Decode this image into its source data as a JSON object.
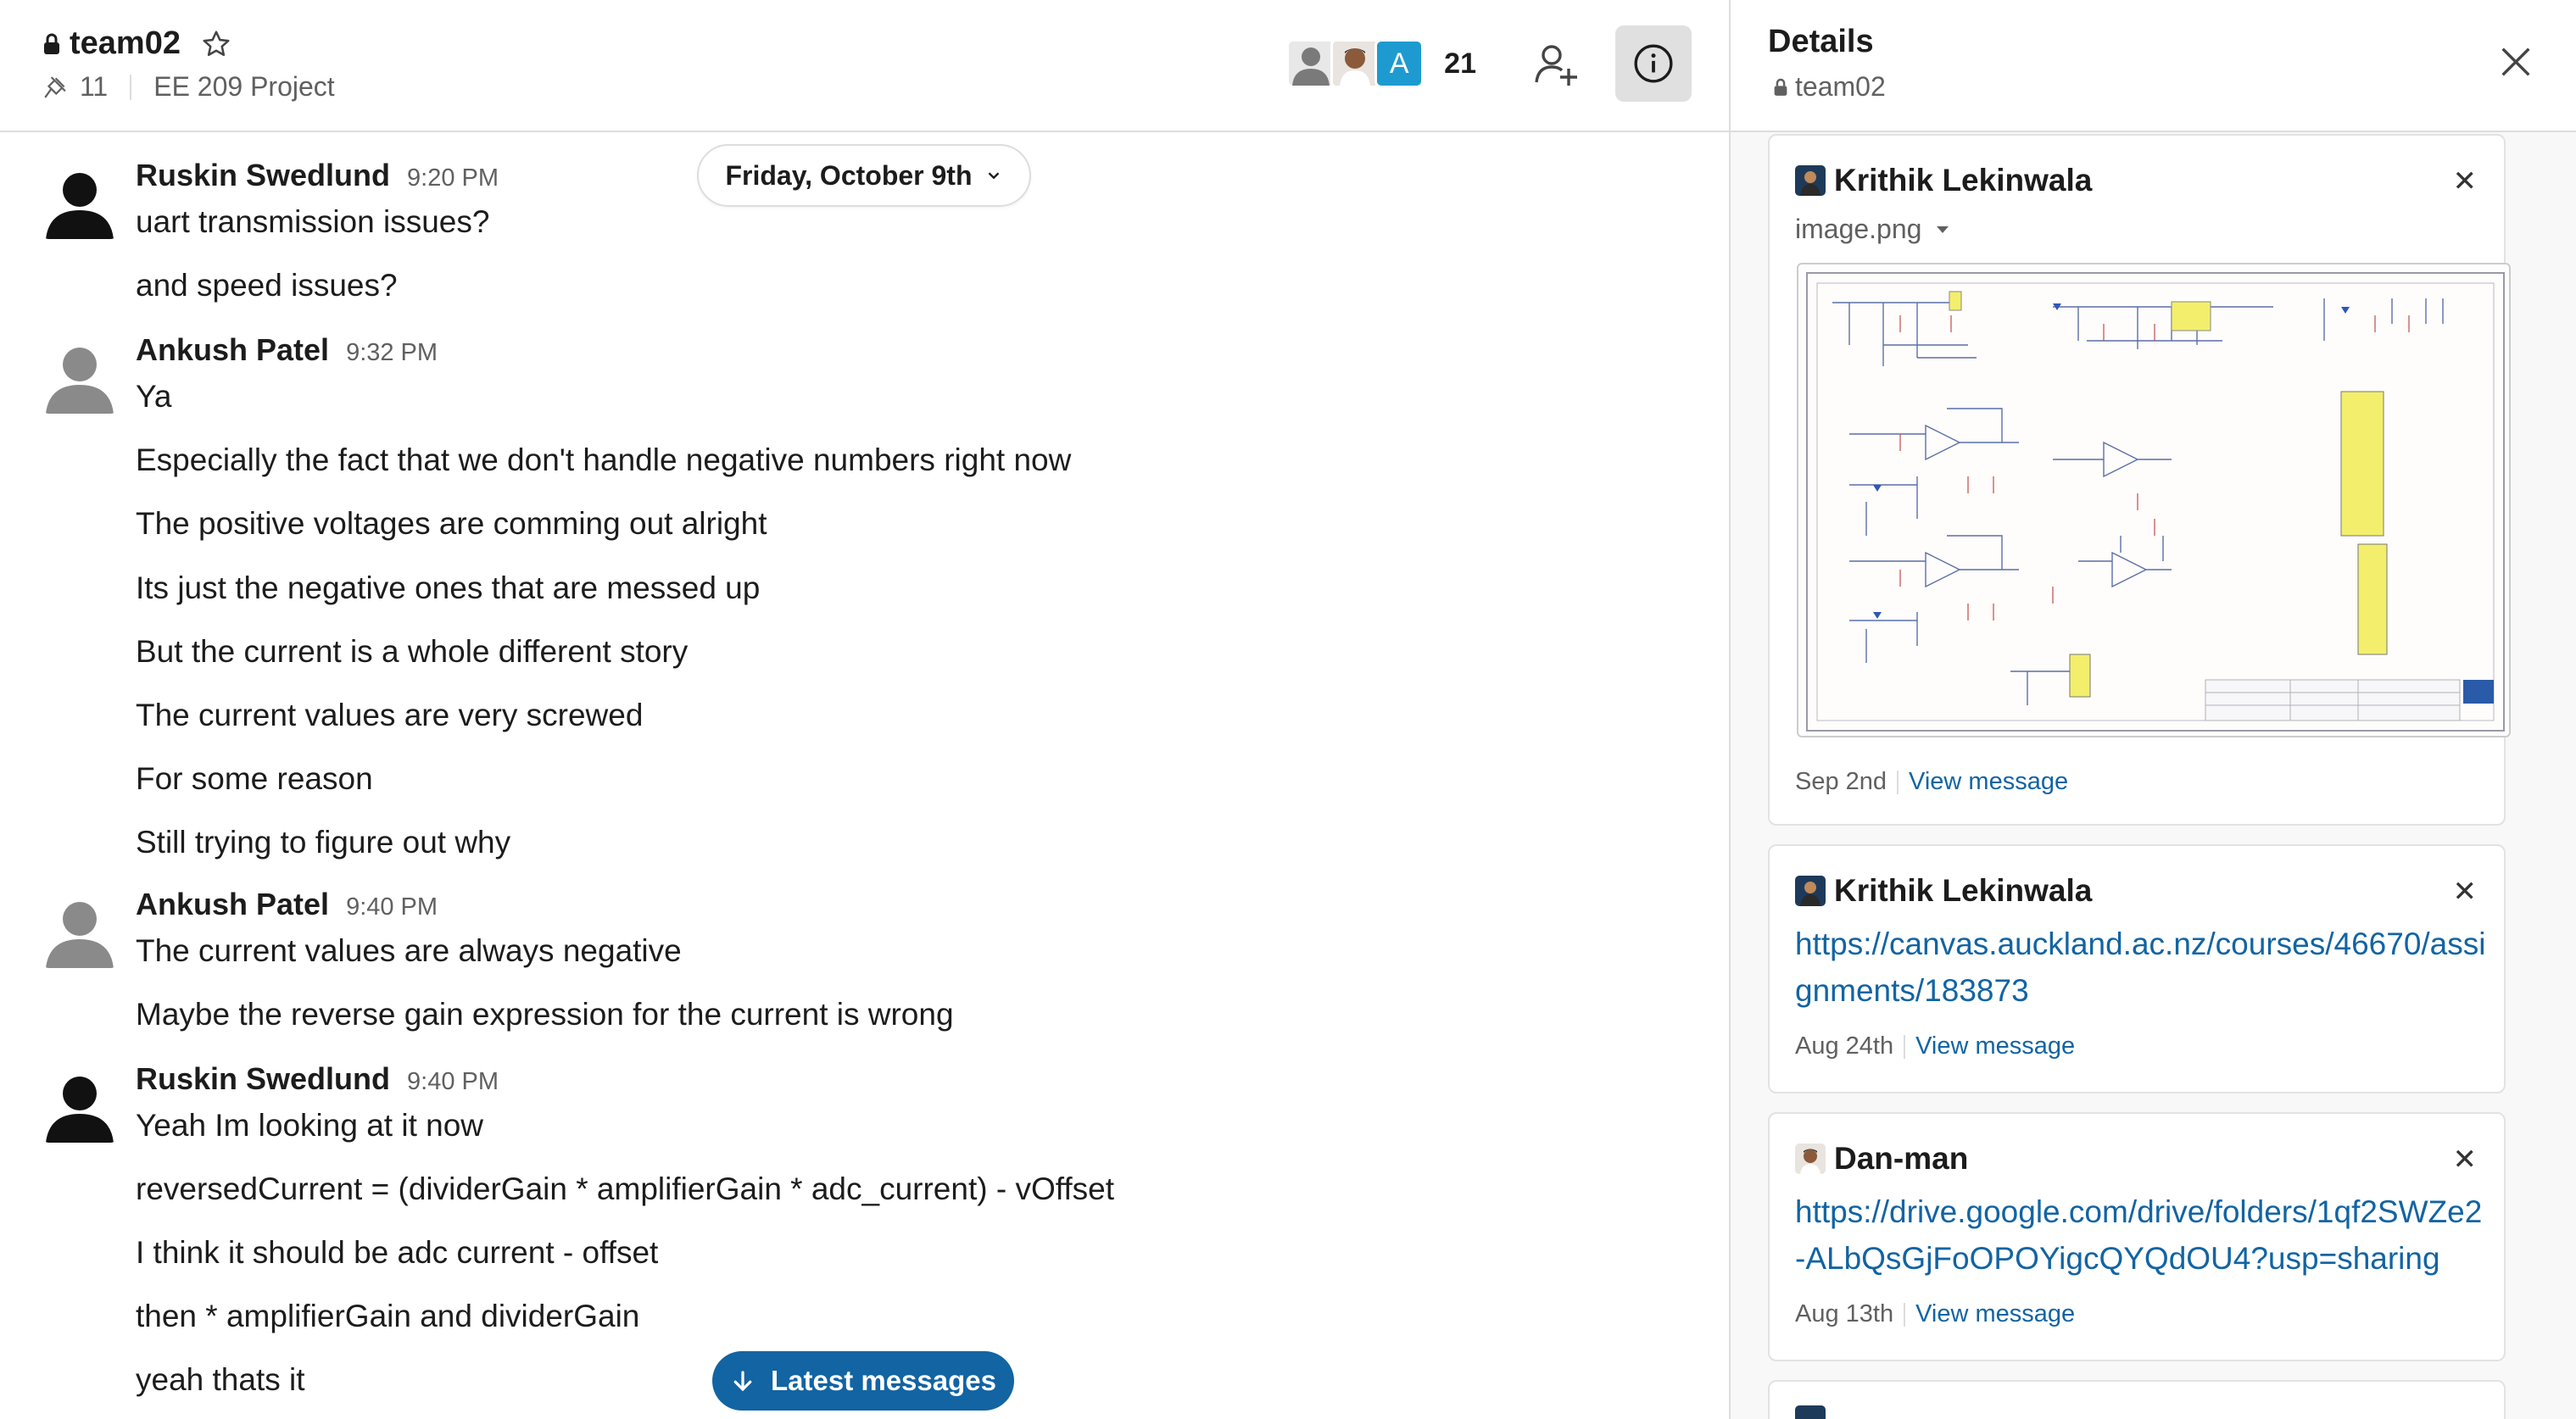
{
  "header": {
    "channel_name": "team02",
    "pinned_count": "11",
    "topic": "EE 209 Project",
    "avatar_letter": "A",
    "member_count": "21"
  },
  "date_divider": "Friday, October 9th",
  "messages": [
    {
      "author": "Ruskin Swedlund",
      "time": "9:20 PM",
      "lines": [
        "uart transmission issues?",
        "and speed issues?"
      ]
    },
    {
      "author": "Ankush Patel",
      "time": "9:32 PM",
      "lines": [
        "Ya",
        "Especially the fact that we don't handle negative numbers right now",
        "The positive voltages are comming out alright",
        "Its just the negative ones that are messed up",
        "But the current is a whole different story",
        "The current values are very screwed",
        "For some reason",
        "Still trying to figure out why"
      ]
    },
    {
      "author": "Ankush Patel",
      "time": "9:40 PM",
      "lines": [
        "The current values are always negative",
        "Maybe the reverse gain expression for the current is wrong"
      ]
    },
    {
      "author": "Ruskin Swedlund",
      "time": "9:40 PM",
      "lines": [
        "Yeah Im  looking at it now",
        "reversedCurrent = (dividerGain * amplifierGain * adc_current) - vOffset",
        "I think it should be adc current - offset",
        "then * amplifierGain and dividerGain",
        "yeah thats it"
      ]
    }
  ],
  "latest_button": "Latest messages",
  "details": {
    "title": "Details",
    "channel": "team02",
    "view_label": "View message",
    "cards": [
      {
        "author": "Krithik Lekinwala",
        "file": "image.png",
        "date": "Sep 2nd"
      },
      {
        "author": "Krithik Lekinwala",
        "link": "https://canvas.auckland.ac.nz/courses/46670/assignments/183873",
        "date": "Aug 24th"
      },
      {
        "author": "Dan-man",
        "link": "https://drive.google.com/drive/folders/1qf2SWZe2-ALbQsGjFoOPOYigcQYQdOU4?usp=sharing",
        "date": "Aug 13th"
      }
    ]
  },
  "colors": {
    "link": "#1264a3",
    "latest_button_bg": "#1264a3",
    "active_info_bg": "#e0e0e0",
    "avatar_letter_bg": "#1d9bd1"
  }
}
